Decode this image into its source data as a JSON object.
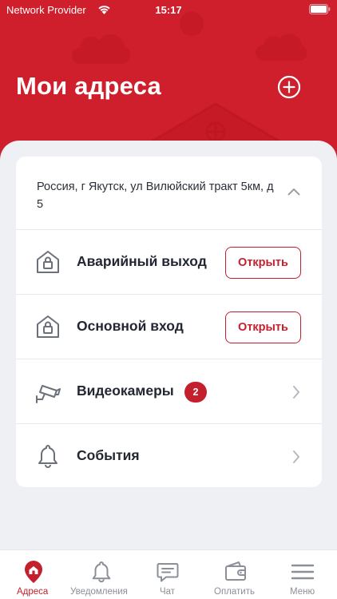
{
  "status_bar": {
    "provider": "Network Provider",
    "time": "15:17"
  },
  "header": {
    "title": "Мои адреса",
    "add_icon": "plus-circle-icon"
  },
  "address_card": {
    "address": "Россия, г Якутск, ул Вилюйский тракт 5км, д 5",
    "rows": [
      {
        "label": "Аварийный выход",
        "icon": "lock-house-icon",
        "action_label": "Открыть"
      },
      {
        "label": "Основной вход",
        "icon": "lock-house-icon",
        "action_label": "Открыть"
      },
      {
        "label": "Видеокамеры",
        "icon": "camera-icon",
        "badge": "2"
      },
      {
        "label": "События",
        "icon": "bell-icon"
      }
    ]
  },
  "tabbar": {
    "items": [
      {
        "label": "Адреса",
        "icon": "home-pin-icon",
        "active": true
      },
      {
        "label": "Уведомления",
        "icon": "bell-icon",
        "active": false
      },
      {
        "label": "Чат",
        "icon": "chat-icon",
        "active": false
      },
      {
        "label": "Оплатить",
        "icon": "wallet-icon",
        "active": false
      },
      {
        "label": "Меню",
        "icon": "menu-icon",
        "active": false
      }
    ]
  },
  "colors": {
    "brand_red": "#d01f2c",
    "accent_red": "#c41f2c",
    "background": "#eef0f3"
  }
}
